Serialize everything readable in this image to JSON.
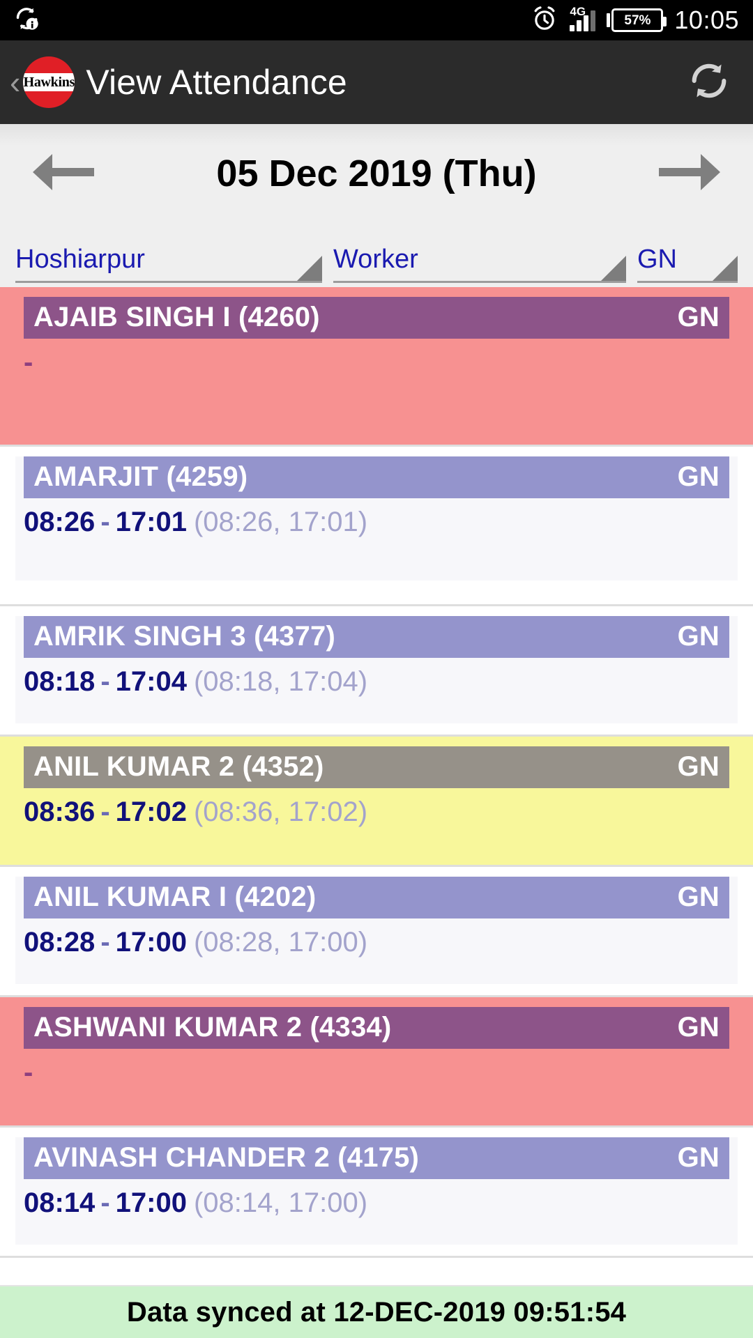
{
  "statusbar": {
    "sync_icon": "sync-info-icon",
    "alarm_icon": "alarm-clock-icon",
    "network_label": "4G",
    "battery_percent": "57%",
    "time": "10:05"
  },
  "appbar": {
    "back_label": "‹",
    "logo_text": "Hawkins",
    "title": "View Attendance",
    "refresh_icon": "refresh-icon"
  },
  "datenav": {
    "prev_icon": "arrow-left-icon",
    "date": "05 Dec 2019 (Thu)",
    "next_icon": "arrow-right-icon"
  },
  "filters": [
    {
      "name": "location",
      "value": "Hoshiarpur"
    },
    {
      "name": "category",
      "value": "Worker"
    },
    {
      "name": "shift",
      "value": "GN"
    }
  ],
  "colors": {
    "absent_bg": "#f79191",
    "absent_header": "#8d5489",
    "present_header": "#9494cc",
    "present_bg": "#f7f7fa",
    "late_bg": "#f8f79b",
    "late_header": "#969189",
    "footer_bg": "#ccf2cc",
    "accent_blue": "#1a1ab0",
    "time_navy": "#11117a"
  },
  "records": [
    {
      "name": "AJAIB SINGH I (4260)",
      "shift": "GN",
      "status": "absent",
      "in_time": "",
      "out_time": "",
      "raw": "",
      "placeholder": "-",
      "tall": true
    },
    {
      "name": "AMARJIT (4259)",
      "shift": "GN",
      "status": "present",
      "in_time": "08:26",
      "out_time": "17:01",
      "raw": "(08:26, 17:01)",
      "placeholder": "",
      "tall": true
    },
    {
      "name": "AMRIK SINGH 3 (4377)",
      "shift": "GN",
      "status": "present",
      "in_time": "08:18",
      "out_time": "17:04",
      "raw": "(08:18, 17:04)",
      "placeholder": "",
      "tall": false
    },
    {
      "name": "ANIL KUMAR 2 (4352)",
      "shift": "GN",
      "status": "late",
      "in_time": "08:36",
      "out_time": "17:02",
      "raw": "(08:36, 17:02)",
      "placeholder": "",
      "tall": false
    },
    {
      "name": "ANIL KUMAR I (4202)",
      "shift": "GN",
      "status": "present",
      "in_time": "08:28",
      "out_time": "17:00",
      "raw": "(08:28, 17:00)",
      "placeholder": "",
      "tall": false
    },
    {
      "name": "ASHWANI KUMAR 2 (4334)",
      "shift": "GN",
      "status": "absent",
      "in_time": "",
      "out_time": "",
      "raw": "",
      "placeholder": "-",
      "tall": false
    },
    {
      "name": "AVINASH CHANDER 2 (4175)",
      "shift": "GN",
      "status": "present",
      "in_time": "08:14",
      "out_time": "17:00",
      "raw": "(08:14, 17:00)",
      "placeholder": "",
      "tall": false
    }
  ],
  "footer": {
    "sync_message": "Data synced at 12-DEC-2019 09:51:54"
  },
  "time_separator": "-"
}
